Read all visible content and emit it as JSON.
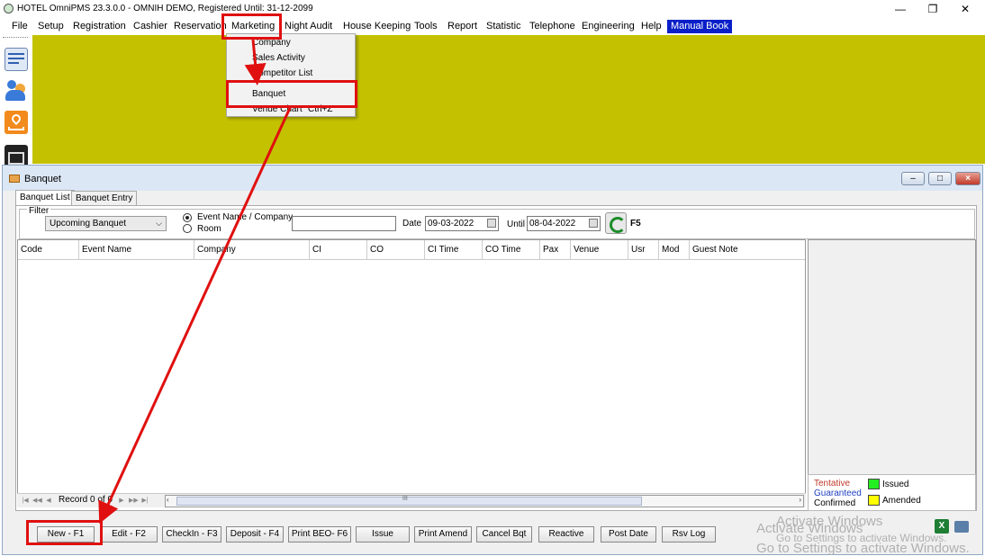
{
  "app": {
    "title": "HOTEL OmniPMS 23.3.0.0 - OMNIH DEMO, Registered Until: 31-12-2099",
    "window_controls": {
      "minimize": "—",
      "restore": "❐",
      "close": "✕"
    }
  },
  "menubar": {
    "items": [
      "File",
      "Setup",
      "Registration",
      "Cashier",
      "Reservation",
      "Marketing",
      "Night Audit",
      "House Keeping",
      "Tools",
      "Report",
      "Statistic",
      "Telephone",
      "Engineering",
      "Help",
      "Manual Book"
    ]
  },
  "marketing_menu": {
    "items": [
      {
        "label": "Company",
        "shortcut": ""
      },
      {
        "label": "Sales Activity",
        "shortcut": ""
      },
      {
        "label": "Competitor List",
        "shortcut": ""
      },
      {
        "label": "Banquet",
        "shortcut": ""
      },
      {
        "label": "Venue Chart",
        "shortcut": "Ctrl+Z"
      }
    ]
  },
  "colors": {
    "desktop": "#c3c100",
    "highlight": "#e01010",
    "manual_book": "#0a1fc8",
    "issued": "#22ee22",
    "amended": "#ffff00",
    "tentative": "#c0392b",
    "guaranteed": "#1f3fbf"
  },
  "left_icons": [
    "editor-icon",
    "users-icon",
    "map-icon",
    "calendar-icon"
  ],
  "banquet_window": {
    "title": "Banquet",
    "tabs": [
      "Banquet List",
      "Banquet Entry"
    ],
    "filter": {
      "label": "Filter",
      "selected": "Upcoming Banquet",
      "radio_event": "Event Name / Company",
      "radio_room": "Room",
      "search_value": "",
      "date_label": "Date",
      "date_from": "09-03-2022",
      "until_label": "Until",
      "date_until": "08-04-2022",
      "refresh_key": "F5"
    },
    "columns": [
      "Code",
      "Event Name",
      "Company",
      "CI",
      "CO",
      "CI Time",
      "CO Time",
      "Pax",
      "Venue",
      "Usr",
      "Mod",
      "Guest Note"
    ],
    "record_label": "Record 0 of 0",
    "scroll_mark": "III",
    "legend": {
      "tentative": "Tentative",
      "guaranteed": "Guaranteed",
      "confirmed": "Confirmed",
      "issued": "Issued",
      "amended": "Amended"
    },
    "buttons": [
      "New - F1",
      "Edit - F2",
      "CheckIn - F3",
      "Deposit - F4",
      "Print BEO- F6",
      "Issue",
      "Print Amend",
      "Cancel Bqt",
      "Reactive",
      "Post Date",
      "Rsv Log"
    ]
  },
  "watermark": {
    "line1": "Activate Windows",
    "line2": "Go to Settings to activate Windows."
  }
}
